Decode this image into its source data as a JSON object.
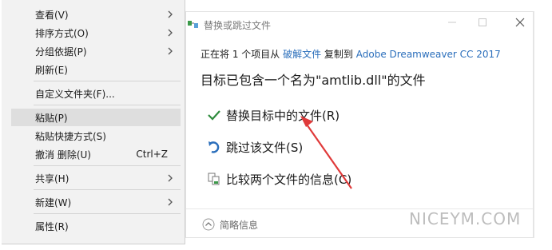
{
  "context_menu": {
    "items": [
      {
        "label": "查看(V)",
        "shortcut": "",
        "submenu": true
      },
      {
        "label": "排序方式(O)",
        "shortcut": "",
        "submenu": true
      },
      {
        "label": "分组依据(P)",
        "shortcut": "",
        "submenu": true
      },
      {
        "label": "刷新(E)",
        "shortcut": "",
        "submenu": false
      },
      {
        "label": "自定义文件夹(F)...",
        "shortcut": "",
        "submenu": false
      },
      {
        "label": "粘贴(P)",
        "shortcut": "",
        "submenu": false,
        "highlighted": true
      },
      {
        "label": "粘贴快捷方式(S)",
        "shortcut": "",
        "submenu": false
      },
      {
        "label": "撤消 删除(U)",
        "shortcut": "Ctrl+Z",
        "submenu": false
      },
      {
        "label": "共享(H)",
        "shortcut": "",
        "submenu": true
      },
      {
        "label": "新建(W)",
        "shortcut": "",
        "submenu": true
      },
      {
        "label": "属性(R)",
        "shortcut": "",
        "submenu": false
      }
    ]
  },
  "dialog": {
    "title": "替换或跳过文件",
    "copy_prefix": "正在将 1 个项目从 ",
    "source": "破解文件",
    "copy_middle": " 复制到 ",
    "destination": "Adobe Dreamweaver CC 2017",
    "heading": "目标已包含一个名为\"amtlib.dll\"的文件",
    "options": [
      {
        "label": "替换目标中的文件(R)",
        "icon": "checkmark-icon"
      },
      {
        "label": "跳过该文件(S)",
        "icon": "skip-icon"
      },
      {
        "label": "比较两个文件的信息(C)",
        "icon": "compare-icon"
      }
    ],
    "details_label": "简略信息"
  },
  "watermark": "NICEYM.COM",
  "colors": {
    "menu_bg": "#f2f2f2",
    "menu_highlight": "#dedede",
    "link": "#2a6ebb",
    "check_green": "#2e8b3d",
    "skip_blue": "#2a6ebb",
    "annotation_arrow": "#e03a3a"
  }
}
